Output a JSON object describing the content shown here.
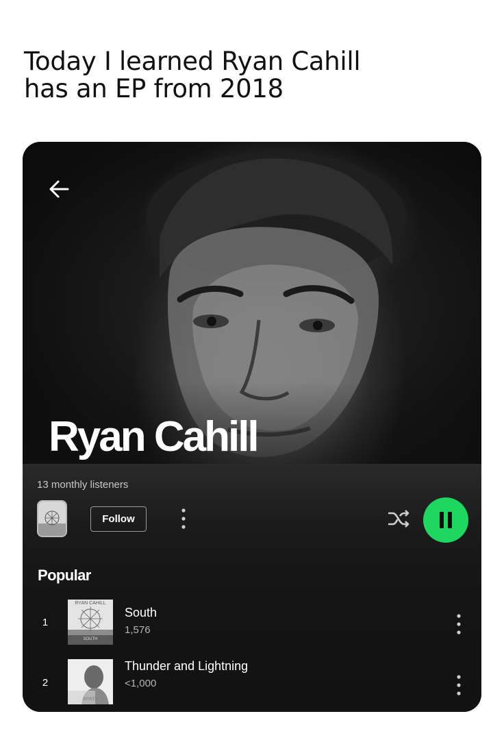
{
  "post": {
    "caption_line1": "Today I learned Ryan Cahill",
    "caption_line2": "has an EP from 2018"
  },
  "artist": {
    "name": "Ryan Cahill",
    "monthly_listeners": "13 monthly listeners"
  },
  "actions": {
    "follow_label": "Follow",
    "back_icon": "arrow-left-icon",
    "more_icon": "more-vertical-icon",
    "shuffle_icon": "shuffle-icon",
    "play_icon": "pause-icon"
  },
  "popular": {
    "heading": "Popular",
    "tracks": [
      {
        "rank": "1",
        "title": "South",
        "plays": "1,576",
        "cover_text_top": "RYAN CAHILL",
        "cover_text_bottom": "SOUTH"
      },
      {
        "rank": "2",
        "title": "Thunder and Lightning",
        "plays": "<1,000",
        "cover_text_top": "",
        "cover_text_bottom": "EPISTS"
      }
    ]
  },
  "colors": {
    "accent": "#1ed760",
    "background": "#121212",
    "text_primary": "#ffffff",
    "text_secondary": "#b5b5b5"
  }
}
